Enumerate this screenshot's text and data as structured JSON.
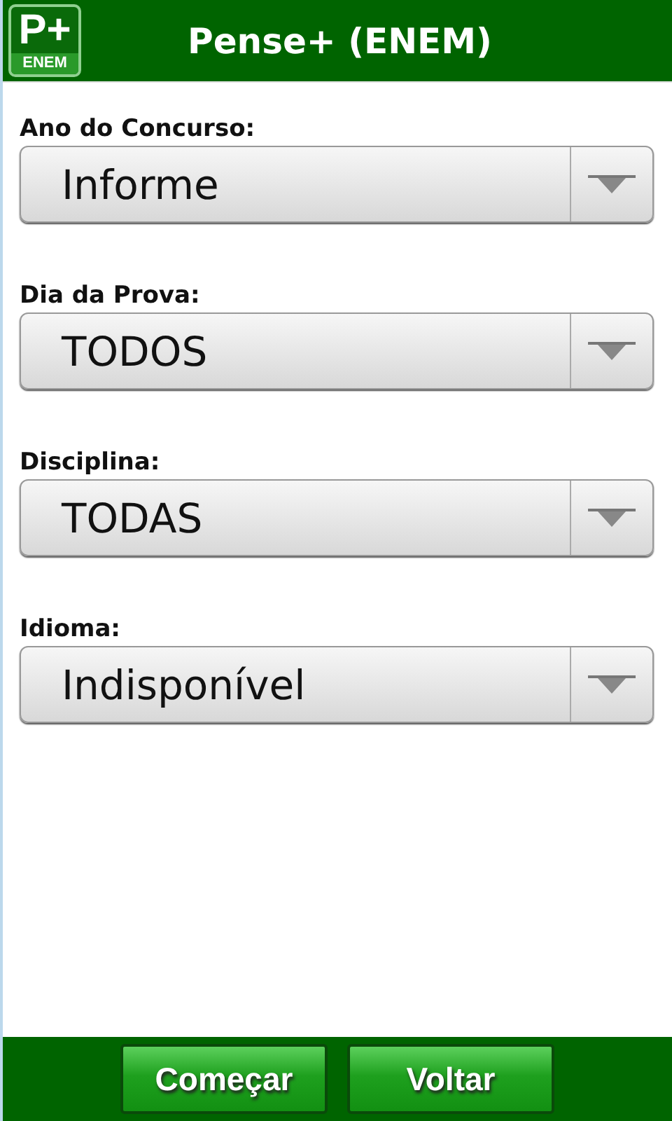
{
  "header": {
    "logo_main": "P+",
    "logo_sub": "ENEM",
    "title": "Pense+ (ENEM)"
  },
  "fields": [
    {
      "label": "Ano do Concurso:",
      "value": "Informe"
    },
    {
      "label": "Dia da Prova:",
      "value": "TODOS"
    },
    {
      "label": "Disciplina:",
      "value": "TODAS"
    },
    {
      "label": "Idioma:",
      "value": "Indisponível"
    }
  ],
  "buttons": [
    "Começar",
    "Voltar"
  ]
}
